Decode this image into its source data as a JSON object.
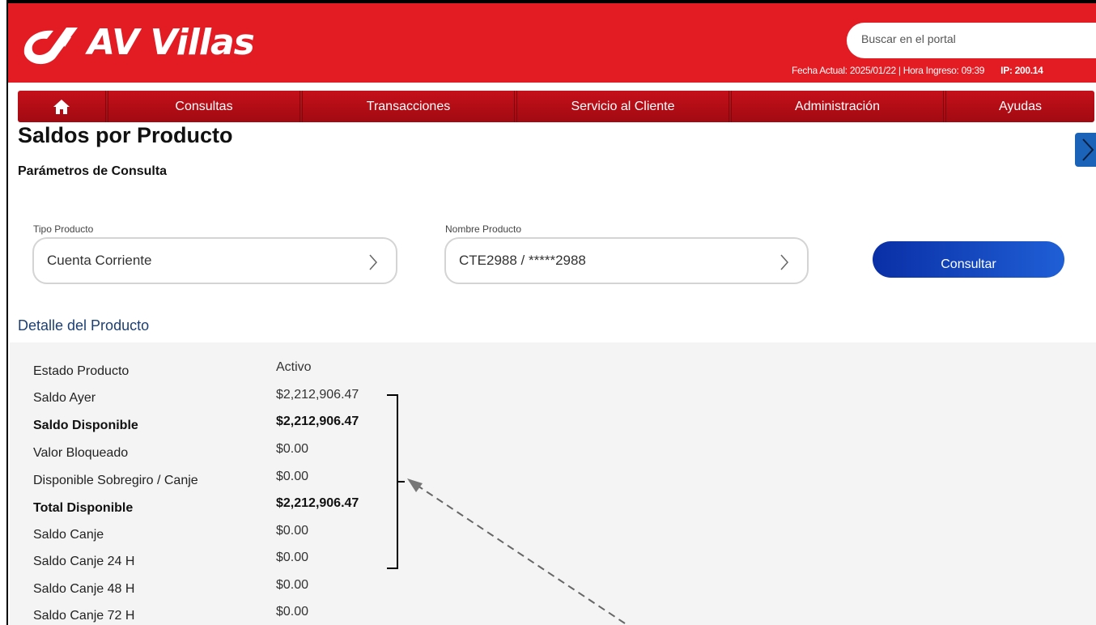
{
  "brand": {
    "name": "AV Villas"
  },
  "header": {
    "search_placeholder": "Buscar en el portal",
    "session_info": "Fecha Actual: 2025/01/22 | Hora Ingreso: 09:39",
    "ip": "IP: 200.14"
  },
  "nav": {
    "home_icon": "home-icon",
    "items": [
      "Consultas",
      "Transacciones",
      "Servicio al Cliente",
      "Administración",
      "Ayudas"
    ]
  },
  "page": {
    "title": "Saldos por Producto",
    "params_title": "Parámetros de Consulta"
  },
  "form": {
    "tipo_label": "Tipo Producto",
    "tipo_value": "Cuenta Corriente",
    "nombre_label": "Nombre Producto",
    "nombre_value": "CTE2988 / *****2988",
    "consultar_label": "Consultar"
  },
  "detail": {
    "title": "Detalle del Producto",
    "rows": [
      {
        "label": "Estado Producto",
        "value": "Activo",
        "bold": false
      },
      {
        "label": "Saldo Ayer",
        "value": "$2,212,906.47",
        "bold": false
      },
      {
        "label": "Saldo Disponible",
        "value": "$2,212,906.47",
        "bold": true
      },
      {
        "label": "Valor Bloqueado",
        "value": "$0.00",
        "bold": false
      },
      {
        "label": "Disponible Sobregiro / Canje",
        "value": "$0.00",
        "bold": false
      },
      {
        "label": "Total Disponible",
        "value": "$2,212,906.47",
        "bold": true
      },
      {
        "label": "Saldo Canje",
        "value": "$0.00",
        "bold": false
      },
      {
        "label": "Saldo Canje 24 H",
        "value": "$0.00",
        "bold": false
      },
      {
        "label": "Saldo Canje 48 H",
        "value": "$0.00",
        "bold": false
      },
      {
        "label": "Saldo Canje 72 H",
        "value": "$0.00",
        "bold": false
      }
    ]
  },
  "colors": {
    "brand_red": "#e31b23",
    "nav_red": "#b00d16",
    "button_blue": "#0a2fa6",
    "detail_title": "#1d3f73"
  }
}
